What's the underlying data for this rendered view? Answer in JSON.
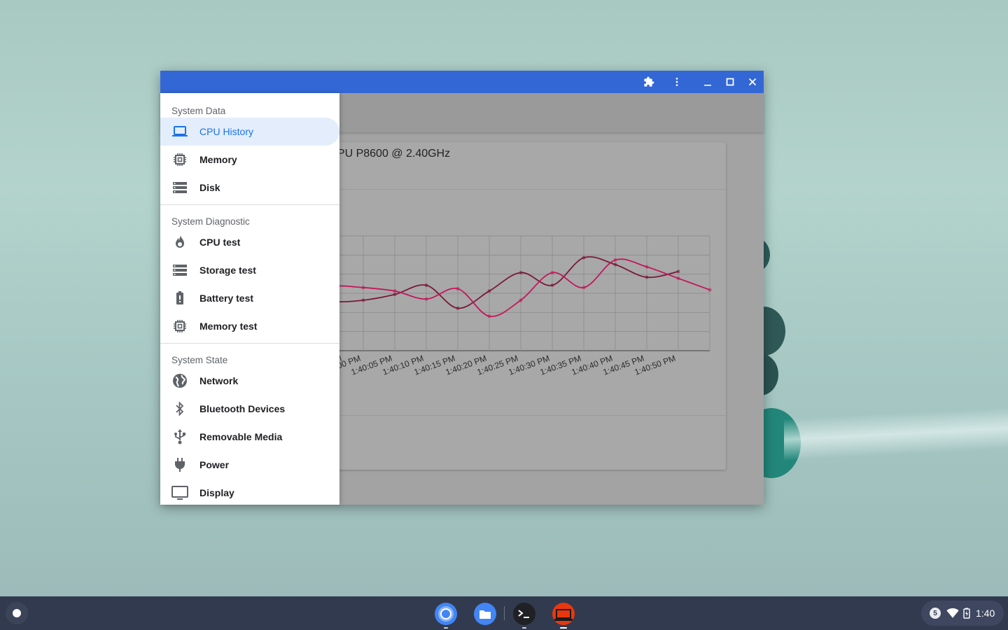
{
  "window": {
    "card_title": "o CPU P8600 @ 2.40GHz",
    "titlebar_buttons": [
      "extension-icon",
      "more-vert-icon",
      "minimize-icon",
      "maximize-icon",
      "close-icon"
    ]
  },
  "drawer": {
    "sections": [
      {
        "header": "System Data",
        "items": [
          {
            "label": "CPU History",
            "icon": "laptop-icon",
            "active": true
          },
          {
            "label": "Memory",
            "icon": "chip-icon"
          },
          {
            "label": "Disk",
            "icon": "storage-icon"
          }
        ]
      },
      {
        "header": "System Diagnostic",
        "items": [
          {
            "label": "CPU test",
            "icon": "fire-icon"
          },
          {
            "label": "Storage test",
            "icon": "storage-icon"
          },
          {
            "label": "Battery test",
            "icon": "battery-alert-icon"
          },
          {
            "label": "Memory test",
            "icon": "chip-icon"
          }
        ]
      },
      {
        "header": "System State",
        "items": [
          {
            "label": "Network",
            "icon": "globe-icon"
          },
          {
            "label": "Bluetooth Devices",
            "icon": "bluetooth-icon"
          },
          {
            "label": "Removable Media",
            "icon": "usb-icon"
          },
          {
            "label": "Power",
            "icon": "power-plug-icon"
          },
          {
            "label": "Display",
            "icon": "monitor-icon"
          }
        ]
      }
    ]
  },
  "chart_data": {
    "type": "line",
    "x": [
      "55 PM",
      "1:40:00 PM",
      "1:40:05 PM",
      "1:40:10 PM",
      "1:40:15 PM",
      "1:40:20 PM",
      "1:40:25 PM",
      "1:40:30 PM",
      "1:40:35 PM",
      "1:40:40 PM",
      "1:40:45 PM",
      "1:40:50 PM"
    ],
    "series": [
      {
        "values": [
          50,
          43,
          44,
          49,
          57,
          37,
          52,
          68,
          57,
          81,
          75,
          64,
          69
        ],
        "color": "#7a1838"
      },
      {
        "values": [
          48,
          56,
          55,
          52,
          45,
          54,
          30,
          44,
          68,
          55,
          79,
          73,
          63,
          53
        ],
        "color": "#c2185b"
      }
    ],
    "ylim": [
      0,
      100
    ],
    "grid": true
  },
  "shelf": {
    "apps": [
      "chrome-icon",
      "files-icon",
      "terminal-icon",
      "diagnostics-app-icon"
    ],
    "tray": {
      "notification_count": "5",
      "time": "1:40"
    }
  }
}
